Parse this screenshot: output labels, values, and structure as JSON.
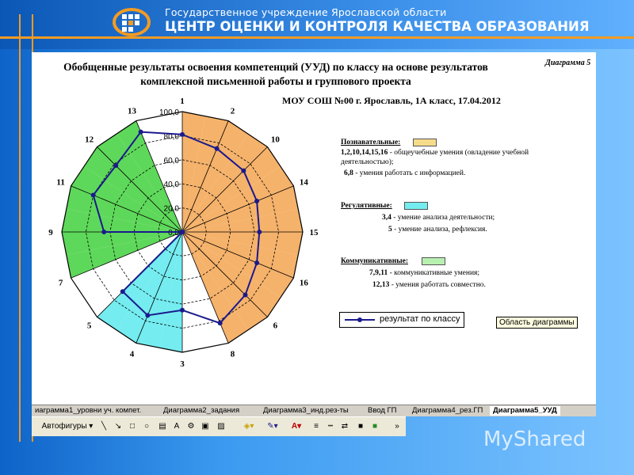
{
  "banner": {
    "line1": "Государственное учреждение Ярославской области",
    "line2": "ЦЕНТР ОЦЕНКИ И КОНТРОЛЯ КАЧЕСТВА ОБРАЗОВАНИЯ"
  },
  "chart_data": {
    "type": "radar",
    "title": "Обобщенные результаты освоения компетенций (УУД) по классу на основе результатов комплексной письменной работы и группового проекта",
    "title_line1": "Обобщенные результаты освоения компетенций (УУД) по классу на основе результатов",
    "title_line2": "комплексной письменной работы и группового проекта",
    "subtitle": "МОУ СОШ №00 г. Ярославль, 1А класс, 17.04.2012",
    "corner_label": "Диаграмма 5",
    "categories": [
      "1",
      "2",
      "10",
      "14",
      "15",
      "16",
      "6",
      "8",
      "3",
      "4",
      "5",
      "7",
      "9",
      "11",
      "12",
      "13"
    ],
    "scale": {
      "min": 0,
      "max": 100,
      "ticks": [
        "0,0",
        "20,0",
        "40,0",
        "60,0",
        "80,0",
        "100,0"
      ]
    },
    "group_colors": {
      "cognitive": "#f5b26b",
      "regulative": "#74ecf0",
      "communicative": "#5ed85a"
    },
    "category_groups": [
      "cognitive",
      "cognitive",
      "cognitive",
      "cognitive",
      "cognitive",
      "cognitive",
      "cognitive",
      "cognitive",
      "regulative",
      "regulative",
      "regulative",
      "communicative",
      "communicative",
      "communicative",
      "communicative",
      "communicative"
    ],
    "series": [
      {
        "name": "результат по классу",
        "values": [
          81,
          75,
          72,
          67,
          64,
          67,
          74,
          82,
          65,
          75,
          70,
          0,
          65,
          80,
          78,
          90
        ]
      }
    ],
    "legend": {
      "cognitive_header": "Познавательные:",
      "cognitive_line1_nums": "1,2,10,14,15,16",
      "cognitive_line1_text": " - общеучебные умения (овладение учебной",
      "cognitive_line2_text": "деятельностью);",
      "cognitive_line3_nums": "6,8",
      "cognitive_line3_text": " - умения работать с информацией.",
      "regulative_header": "Регулятивные:",
      "regulative_line1_nums": "3,4",
      "regulative_line1_text": " -  умение анализа деятельности;",
      "regulative_line2_nums": "5",
      "regulative_line2_text": " - умение анализа, рефлексия.",
      "communicative_header": "Коммуникативные:",
      "communicative_line1_nums": "7,9,11",
      "communicative_line1_text": " - коммуникативные умения;",
      "communicative_line2_nums": "12,13",
      "communicative_line2_text": " - умения работать совместно."
    }
  },
  "chart_area_tooltip": "Область диаграммы",
  "sheet_tabs": [
    "иаграмма1_уровни уч. компет.",
    "Диаграмма2_задания",
    "Диаграмма3_инд.рез-ты",
    "Ввод ГП",
    "Диаграмма4_рез.ГП",
    "Диаграмма5_УУД"
  ],
  "active_tab_index": 5,
  "toolbar": {
    "autoshapes_label": "Автофигуры"
  },
  "watermark": "MyShared"
}
